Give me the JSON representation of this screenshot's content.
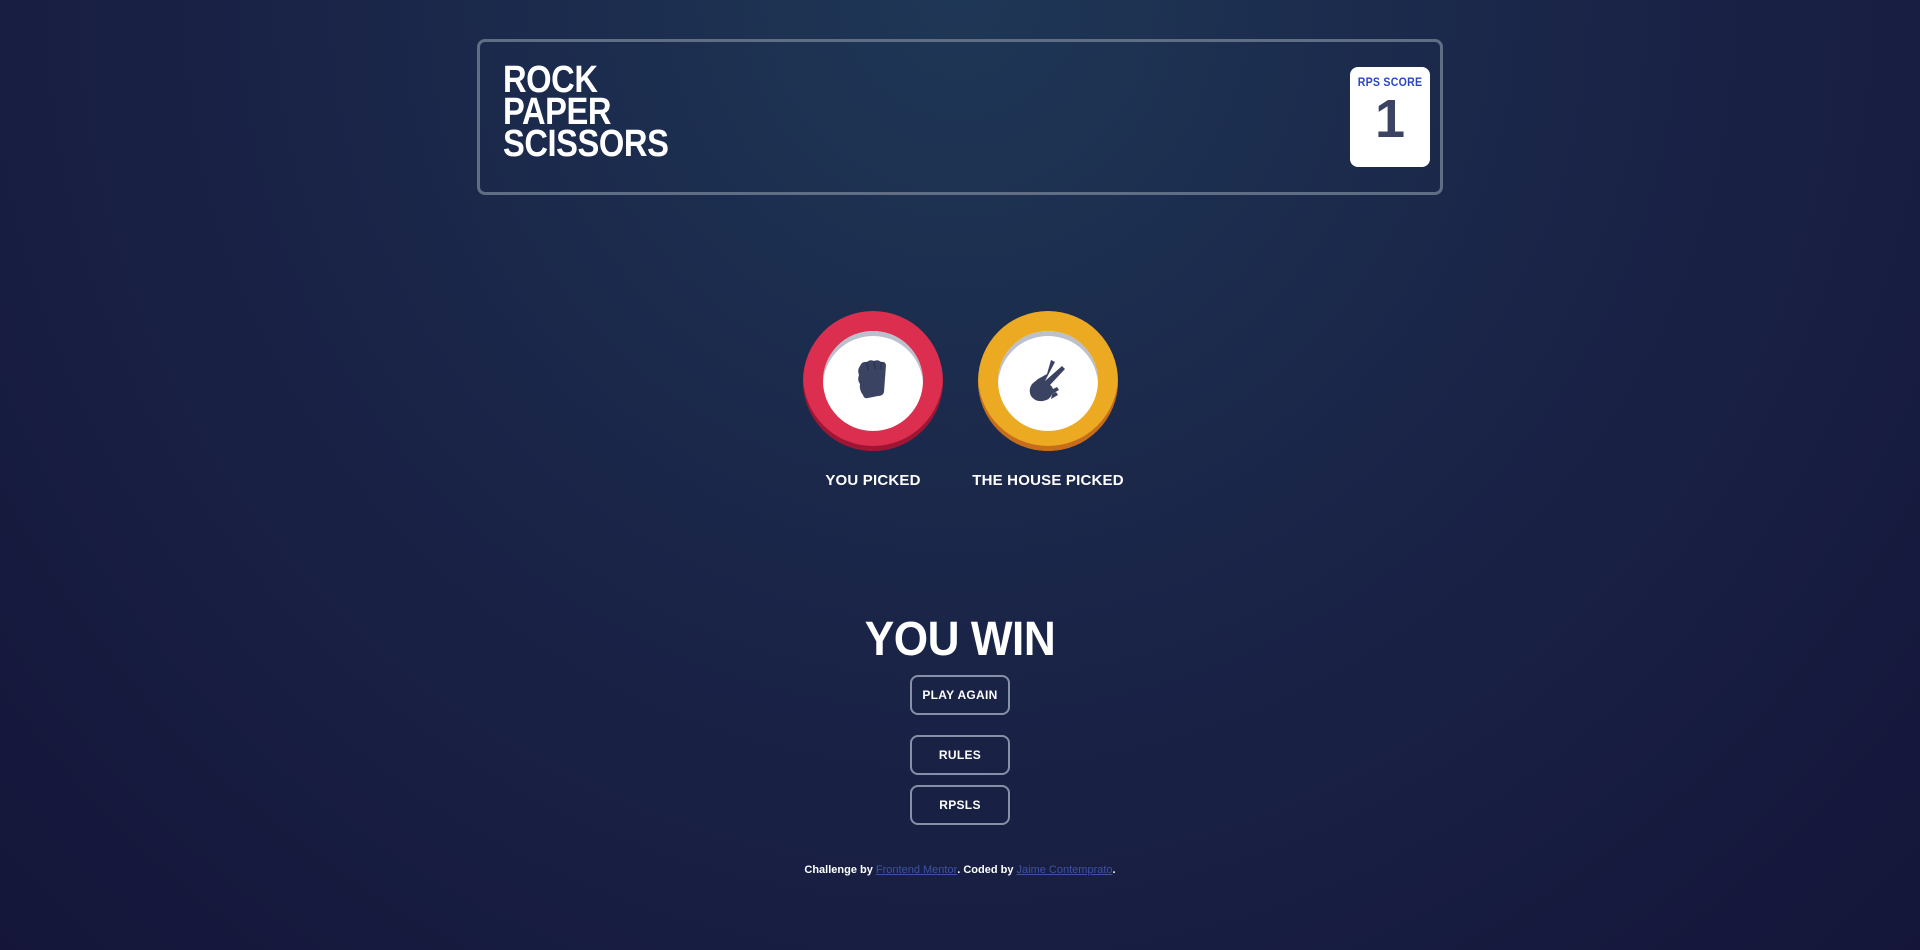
{
  "header": {
    "title_lines": [
      "ROCK",
      "PAPER",
      "SCISSORS"
    ],
    "score_label": "RPS SCORE",
    "score_value": "1"
  },
  "game": {
    "player_pick": {
      "choice": "rock",
      "icon": "rock-hand-icon",
      "label": "YOU PICKED",
      "ring_color": "#dc2e4e"
    },
    "house_pick": {
      "choice": "scissors",
      "icon": "scissors-hand-icon",
      "label": "THE HOUSE PICKED",
      "ring_color": "#eca922"
    },
    "result": "YOU WIN",
    "play_again_label": "PLAY AGAIN"
  },
  "buttons": {
    "rules_label": "RULES",
    "rpsls_label": "RPSLS"
  },
  "footer": {
    "prefix": "Challenge by ",
    "link1": "Frontend Mentor",
    "middle": ". Coded by ",
    "link2": "Jaime Contemprato",
    "suffix": "."
  }
}
